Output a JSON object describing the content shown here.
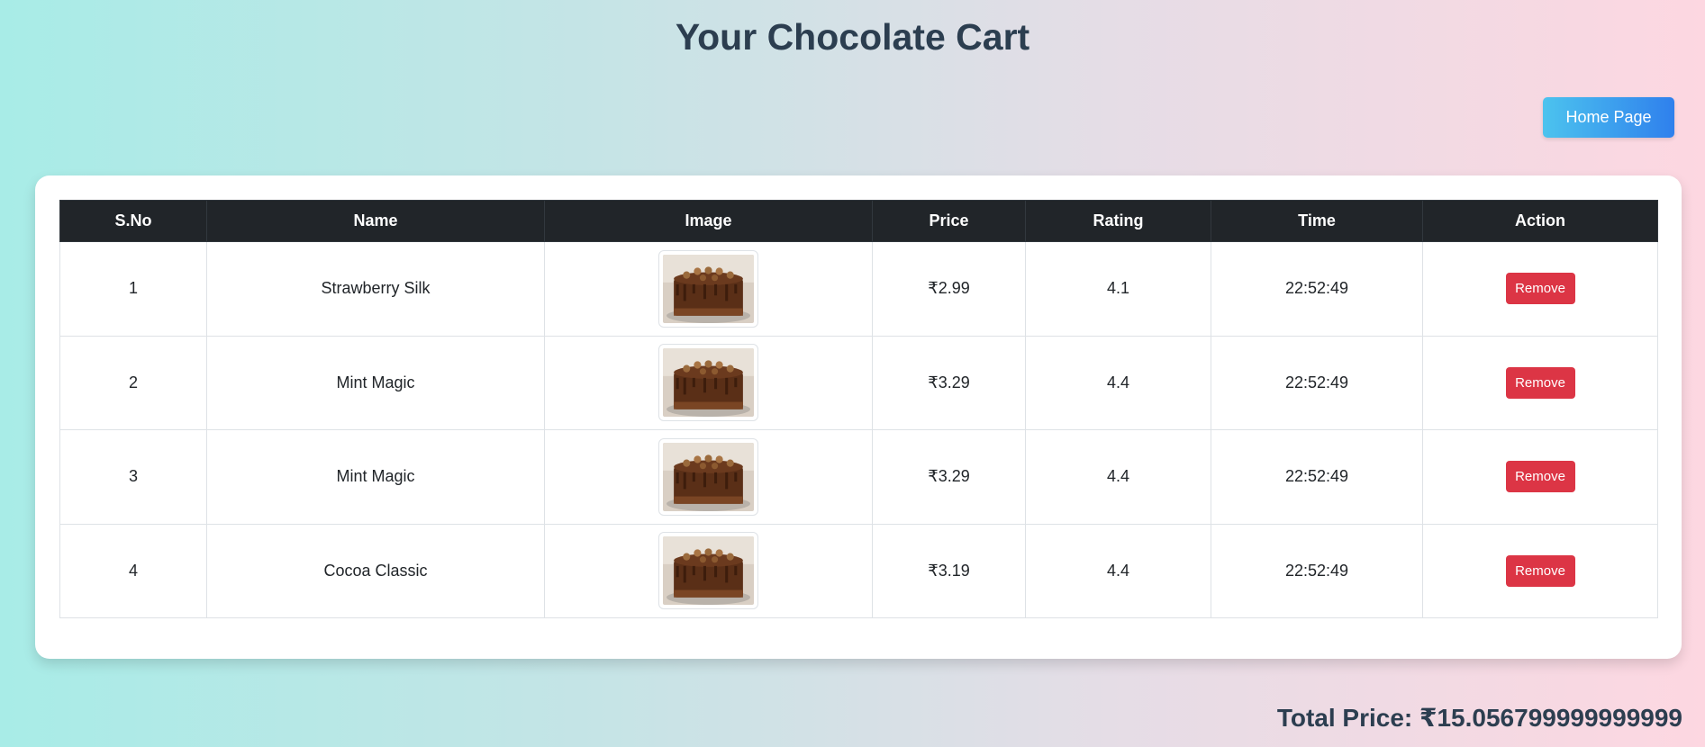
{
  "page": {
    "title": "Your Chocolate Cart"
  },
  "nav": {
    "home_label": "Home Page"
  },
  "table": {
    "headers": [
      "S.No",
      "Name",
      "Image",
      "Price",
      "Rating",
      "Time",
      "Action"
    ],
    "rows": [
      {
        "sno": "1",
        "name": "Strawberry Silk",
        "image": "chocolate-cake-image",
        "price": "₹2.99",
        "rating": "4.1",
        "time": "22:52:49",
        "action": "Remove"
      },
      {
        "sno": "2",
        "name": "Mint Magic",
        "image": "chocolate-cake-image",
        "price": "₹3.29",
        "rating": "4.4",
        "time": "22:52:49",
        "action": "Remove"
      },
      {
        "sno": "3",
        "name": "Mint Magic",
        "image": "chocolate-cake-image",
        "price": "₹3.29",
        "rating": "4.4",
        "time": "22:52:49",
        "action": "Remove"
      },
      {
        "sno": "4",
        "name": "Cocoa Classic",
        "image": "chocolate-cake-image",
        "price": "₹3.19",
        "rating": "4.4",
        "time": "22:52:49",
        "action": "Remove"
      }
    ]
  },
  "summary": {
    "total_label": "Total Price: ₹15.056799999999999"
  },
  "colors": {
    "header_bg": "#212529",
    "remove_button": "#dc3545",
    "home_button_start": "#4cc3ee",
    "home_button_end": "#2f80ed",
    "title_text": "#2c3e50"
  }
}
